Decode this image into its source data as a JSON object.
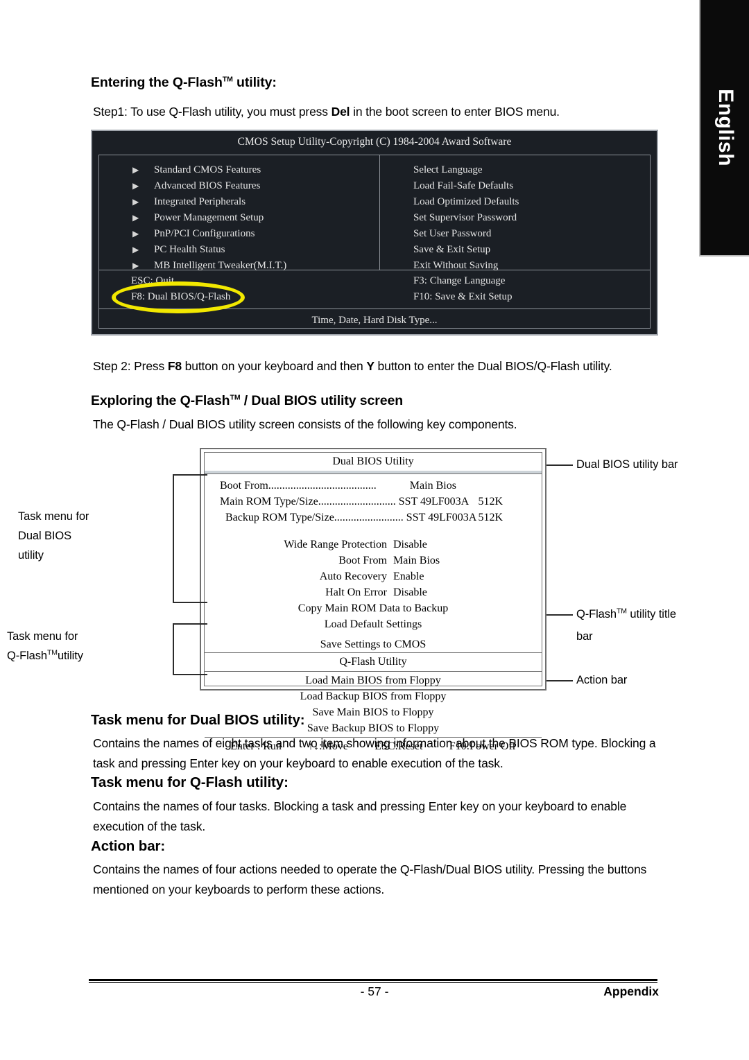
{
  "sidebar": {
    "language_tab": "English"
  },
  "headings": {
    "entering_prefix": "Entering the Q-Flash",
    "entering_tm": "TM",
    "entering_suffix": " utility:",
    "exploring_prefix": "Exploring the Q-Flash",
    "exploring_tm": "TM",
    "exploring_suffix": " / Dual BIOS utility screen",
    "task_menu_dual_bios": "Task menu for Dual BIOS utility:",
    "task_menu_qflash": "Task menu for Q-Flash utility:",
    "action_bar": "Action bar:"
  },
  "paragraphs": {
    "step1_a": "Step1: To use Q-Flash utility, you must press ",
    "step1_key": "Del",
    "step1_b": " in the boot screen to enter BIOS menu.",
    "step2_a": "Step 2: Press ",
    "step2_key1": "F8",
    "step2_b": " button on your keyboard and then ",
    "step2_key2": "Y",
    "step2_c": " button to enter the Dual BIOS/Q-Flash utility.",
    "exploring_body": "The Q-Flash / Dual BIOS utility screen consists of the following key components.",
    "dual_bios_desc": "Contains the names of eight tasks and two item showing information about the BIOS ROM type. Blocking a task and pressing Enter key on your keyboard to enable execution of the task.",
    "qflash_desc": "Contains the names of four tasks. Blocking a task and pressing Enter key on your keyboard to enable execution of the task.",
    "action_bar_desc": "Contains the names of four actions needed to operate the Q-Flash/Dual BIOS utility. Pressing the buttons mentioned on your keyboards to perform these actions."
  },
  "bios_screen": {
    "title": "CMOS Setup Utility-Copyright (C) 1984-2004 Award Software",
    "left_items": [
      "Standard CMOS Features",
      "Advanced BIOS Features",
      "Integrated Peripherals",
      "Power Management Setup",
      "PnP/PCI Configurations",
      "PC Health Status",
      "MB Intelligent Tweaker(M.I.T.)"
    ],
    "right_items": [
      "Select Language",
      "Load Fail-Safe Defaults",
      "Load Optimized Defaults",
      "Set Supervisor Password",
      "Set User Password",
      "Save & Exit Setup",
      "Exit Without Saving"
    ],
    "keys_left": [
      "ESC: Quit",
      "F8: Dual BIOS/Q-Flash"
    ],
    "keys_right": [
      "F3: Change Language",
      "F10: Save & Exit Setup"
    ],
    "footer": "Time, Date, Hard Disk Type...",
    "highlight_color": "#f2e800",
    "background_color": "#1b1f25"
  },
  "diagram": {
    "dual_bios_title": "Dual BIOS Utility",
    "info_rows": [
      {
        "label": "Boot From.......................................",
        "value": "Main Bios",
        "size": ""
      },
      {
        "label": "Main ROM Type/Size............................",
        "value": "SST 49LF003A",
        "size": "512K"
      },
      {
        "label": "Backup ROM Type/Size.........................",
        "value": "SST 49LF003A",
        "size": "512K"
      }
    ],
    "settings": [
      {
        "key": "Wide Range Protection",
        "value": "Disable"
      },
      {
        "key": "Boot From",
        "value": "Main Bios"
      },
      {
        "key": "Auto Recovery",
        "value": "Enable"
      },
      {
        "key": "Halt On Error",
        "value": "Disable"
      }
    ],
    "center_tasks": [
      "Copy Main ROM Data to Backup",
      "Load Default Settings",
      "Save Settings to CMOS"
    ],
    "qflash_title": "Q-Flash Utility",
    "qflash_tasks": [
      "Load Main BIOS from Floppy",
      "Load Backup BIOS from Floppy",
      "Save Main BIOS to Floppy",
      "Save Backup BIOS to Floppy"
    ],
    "action_bar": [
      "Enter : Run",
      "↑↓:Move",
      "ESC:Reset",
      "F10:Power Off"
    ],
    "callouts": {
      "dual_bios_bar": "Dual BIOS utility bar",
      "task_menu_dual_1": "Task menu for",
      "task_menu_dual_2": "Dual BIOS",
      "task_menu_dual_3": "utility",
      "task_menu_qflash_1": "Task menu for",
      "task_menu_qflash_2_prefix": "Q-Flash",
      "task_menu_qflash_2_tm": "TM",
      "task_menu_qflash_2_suffix": "utility",
      "qflash_title_bar_1_prefix": "Q-Flash",
      "qflash_title_bar_1_tm": "TM",
      "qflash_title_bar_1_suffix": " utility title",
      "qflash_title_bar_2": "bar",
      "action_bar": "Action bar"
    }
  },
  "footer": {
    "page_number": "- 57 -",
    "section": "Appendix"
  }
}
